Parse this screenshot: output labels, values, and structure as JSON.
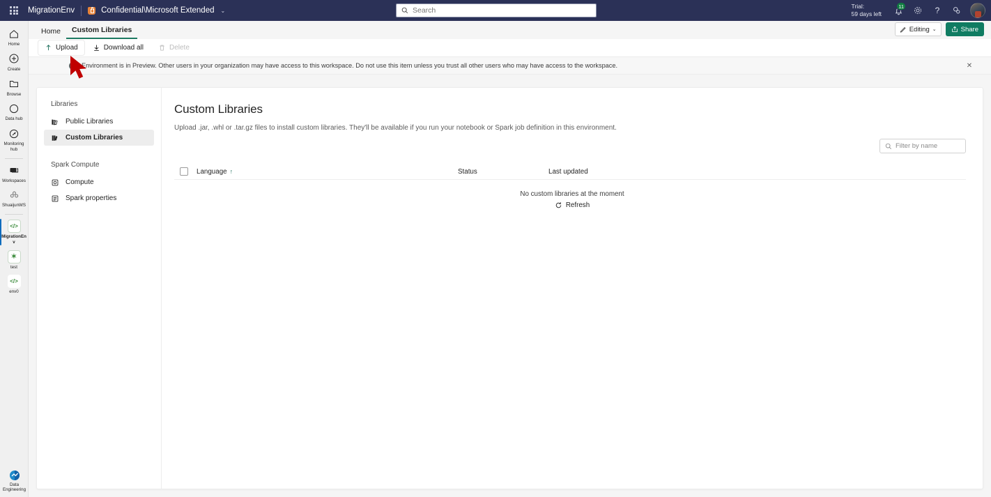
{
  "header": {
    "app_name": "MigrationEnv",
    "sensitivity_label": "Confidential\\Microsoft Extended",
    "sensitivity_chevron": "⌄",
    "search_placeholder": "Search",
    "trial_line1": "Trial:",
    "trial_line2": "59 days left",
    "notification_count": "11",
    "waffle_name": "app-launcher-icon",
    "help_glyph": "?"
  },
  "rail": {
    "items": [
      {
        "label": "Home",
        "icon": "home-icon",
        "selected": false
      },
      {
        "label": "Create",
        "icon": "create-plus-icon",
        "selected": false
      },
      {
        "label": "Browse",
        "icon": "browse-folder-icon",
        "selected": false
      },
      {
        "label": "Data hub",
        "icon": "data-hub-icon",
        "selected": false
      },
      {
        "label": "Monitoring hub",
        "icon": "monitoring-hub-icon",
        "selected": false
      },
      {
        "label": "Workspaces",
        "icon": "workspaces-icon",
        "selected": false
      },
      {
        "label": "ShuaijunWS",
        "icon": "workspace-avatar-icon",
        "selected": false
      },
      {
        "label": "MigrationEnv",
        "icon": "environment-icon",
        "selected": true
      },
      {
        "label": "test",
        "icon": "notebook-icon",
        "selected": false
      },
      {
        "label": "env0",
        "icon": "environment-icon",
        "selected": false
      }
    ],
    "footer": {
      "label": "Data Engineering",
      "icon": "data-engineering-icon"
    }
  },
  "breadcrumb": {
    "items": [
      {
        "label": "Home",
        "active": false
      },
      {
        "label": "Custom Libraries",
        "active": true
      }
    ],
    "editing_label": "Editing",
    "editing_chevron": "⌄",
    "share_label": "Share"
  },
  "toolbar": {
    "upload_label": "Upload",
    "download_all_label": "Download all",
    "delete_label": "Delete"
  },
  "banner": {
    "info_glyph": "i",
    "text": "Environment is in Preview. Other users in your organization may have access to this workspace. Do not use this item unless you trust all other users who may have access to the workspace.",
    "close_glyph": "✕"
  },
  "left_panel": {
    "group1_title": "Libraries",
    "group1_items": [
      {
        "label": "Public Libraries",
        "icon": "public-libraries-icon",
        "selected": false
      },
      {
        "label": "Custom Libraries",
        "icon": "custom-libraries-icon",
        "selected": true
      }
    ],
    "group2_title": "Spark Compute",
    "group2_items": [
      {
        "label": "Compute",
        "icon": "compute-gear-icon",
        "selected": false
      },
      {
        "label": "Spark properties",
        "icon": "spark-properties-icon",
        "selected": false
      }
    ]
  },
  "main": {
    "title": "Custom Libraries",
    "description": "Upload .jar, .whl or .tar.gz files to install custom libraries. They'll be available if you run your notebook or Spark job definition in this environment.",
    "filter_placeholder": "Filter by name",
    "columns": {
      "language": "Language",
      "sort_arrow": "↑",
      "status": "Status",
      "last_updated": "Last updated"
    },
    "rows": [],
    "empty_message": "No custom libraries at the moment",
    "refresh_label": "Refresh"
  },
  "colors": {
    "header_bg": "#2b3157",
    "accent_green": "#107c62",
    "selection_blue": "#0f6cbd",
    "badge_green": "#107c41",
    "cursor_red": "#c00000"
  }
}
